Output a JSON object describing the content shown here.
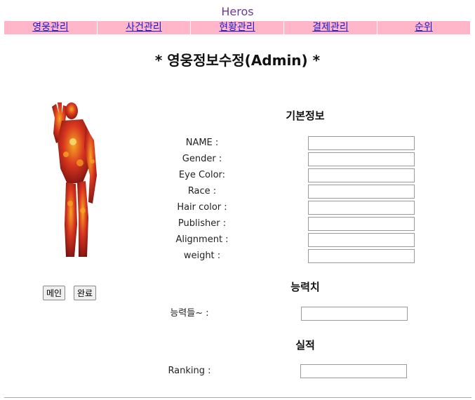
{
  "header": {
    "site_title": "Heros",
    "nav": [
      "영웅관리",
      "사건관리",
      "현황관리",
      "결제관리",
      "순위"
    ]
  },
  "page_title": "* 영웅정보수정(Admin) *",
  "hero_image": {
    "icon": "iron-man-figure",
    "colors": {
      "primary": "#c8201c",
      "highlight": "#f5a623",
      "dark": "#6b0d0d"
    }
  },
  "buttons": {
    "main": "메인",
    "done": "완료"
  },
  "sections": {
    "basic": {
      "heading": "기본정보",
      "fields": [
        {
          "label": "NAME :",
          "value": ""
        },
        {
          "label": "Gender :",
          "value": ""
        },
        {
          "label": "Eye Color:",
          "value": ""
        },
        {
          "label": "Race :",
          "value": ""
        },
        {
          "label": "Hair color :",
          "value": ""
        },
        {
          "label": "Publisher :",
          "value": ""
        },
        {
          "label": "Alignment :",
          "value": ""
        },
        {
          "label": "weight :",
          "value": ""
        }
      ]
    },
    "ability": {
      "heading": "능력치",
      "fields": [
        {
          "label": "능력들~ :",
          "value": ""
        }
      ]
    },
    "record": {
      "heading": "실적",
      "fields": [
        {
          "label": "Ranking :",
          "value": ""
        }
      ]
    }
  }
}
